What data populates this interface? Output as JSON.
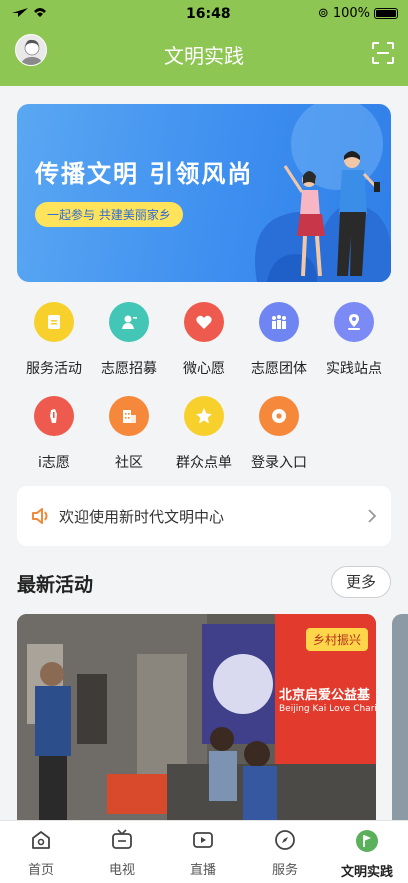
{
  "status": {
    "time": "16:48",
    "battery": "100%"
  },
  "header": {
    "title": "文明实践"
  },
  "banner": {
    "headline": "传播文明 引领风尚",
    "subline": "一起参与 共建美丽家乡"
  },
  "grid": {
    "items": [
      {
        "label": "服务活动",
        "icon": "calendar-icon",
        "color": "#f7d02b"
      },
      {
        "label": "志愿招募",
        "icon": "person-add-icon",
        "color": "#44c6b6"
      },
      {
        "label": "微心愿",
        "icon": "heart-icon",
        "color": "#ee5a4d"
      },
      {
        "label": "志愿团体",
        "icon": "group-icon",
        "color": "#6f86f2"
      },
      {
        "label": "实践站点",
        "icon": "location-icon",
        "color": "#7b8af5"
      },
      {
        "label": "i志愿",
        "icon": "hand-icon",
        "color": "#ee5a4d"
      },
      {
        "label": "社区",
        "icon": "building-icon",
        "color": "#f6883b"
      },
      {
        "label": "群众点单",
        "icon": "star-icon",
        "color": "#f7d02b"
      },
      {
        "label": "登录入口",
        "icon": "login-icon",
        "color": "#f6883b"
      }
    ]
  },
  "notice": {
    "text": "欢迎使用新时代文明中心"
  },
  "latest": {
    "title": "最新活动",
    "more_label": "更多",
    "card_tag": "乡村振兴",
    "banner_text": "北京启爱公益基",
    "banner_text_en": "Beijing Kai Love Charity Fo"
  },
  "tabbar": {
    "items": [
      {
        "label": "首页",
        "icon": "home-icon"
      },
      {
        "label": "电视",
        "icon": "tv-icon"
      },
      {
        "label": "直播",
        "icon": "live-icon"
      },
      {
        "label": "服务",
        "icon": "compass-icon"
      },
      {
        "label": "文明实践",
        "icon": "flag-icon",
        "active": true
      }
    ]
  },
  "colors": {
    "header": "#8ec653",
    "accent": "#5ab05b",
    "banner": "#3e8ff0"
  }
}
